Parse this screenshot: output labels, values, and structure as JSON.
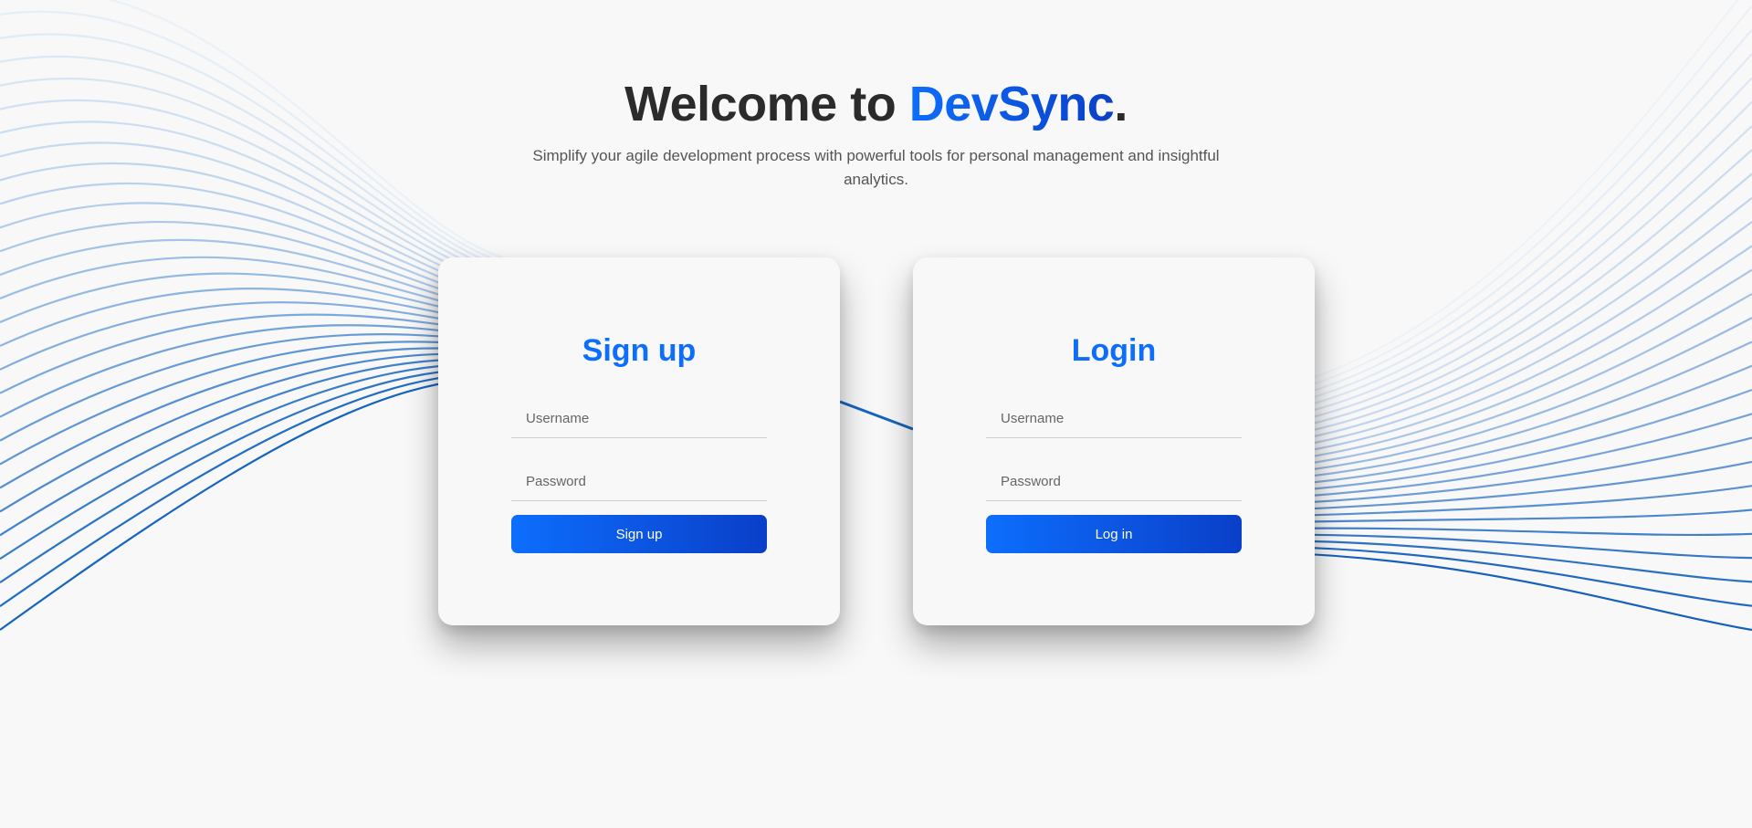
{
  "hero": {
    "title_prefix": "Welcome to ",
    "title_brand": "DevSync",
    "title_suffix": ".",
    "subtitle": "Simplify your agile development process with powerful tools for personal management and insightful analytics."
  },
  "signup": {
    "heading": "Sign up",
    "username_placeholder": "Username",
    "password_placeholder": "Password",
    "button_label": "Sign up"
  },
  "login": {
    "heading": "Login",
    "username_placeholder": "Username",
    "password_placeholder": "Password",
    "button_label": "Log in"
  },
  "colors": {
    "brand_blue": "#0d6efd",
    "brand_blue_dark": "#0a3fc8",
    "text_dark": "#2b2b2b",
    "background": "#f8f8f8"
  }
}
